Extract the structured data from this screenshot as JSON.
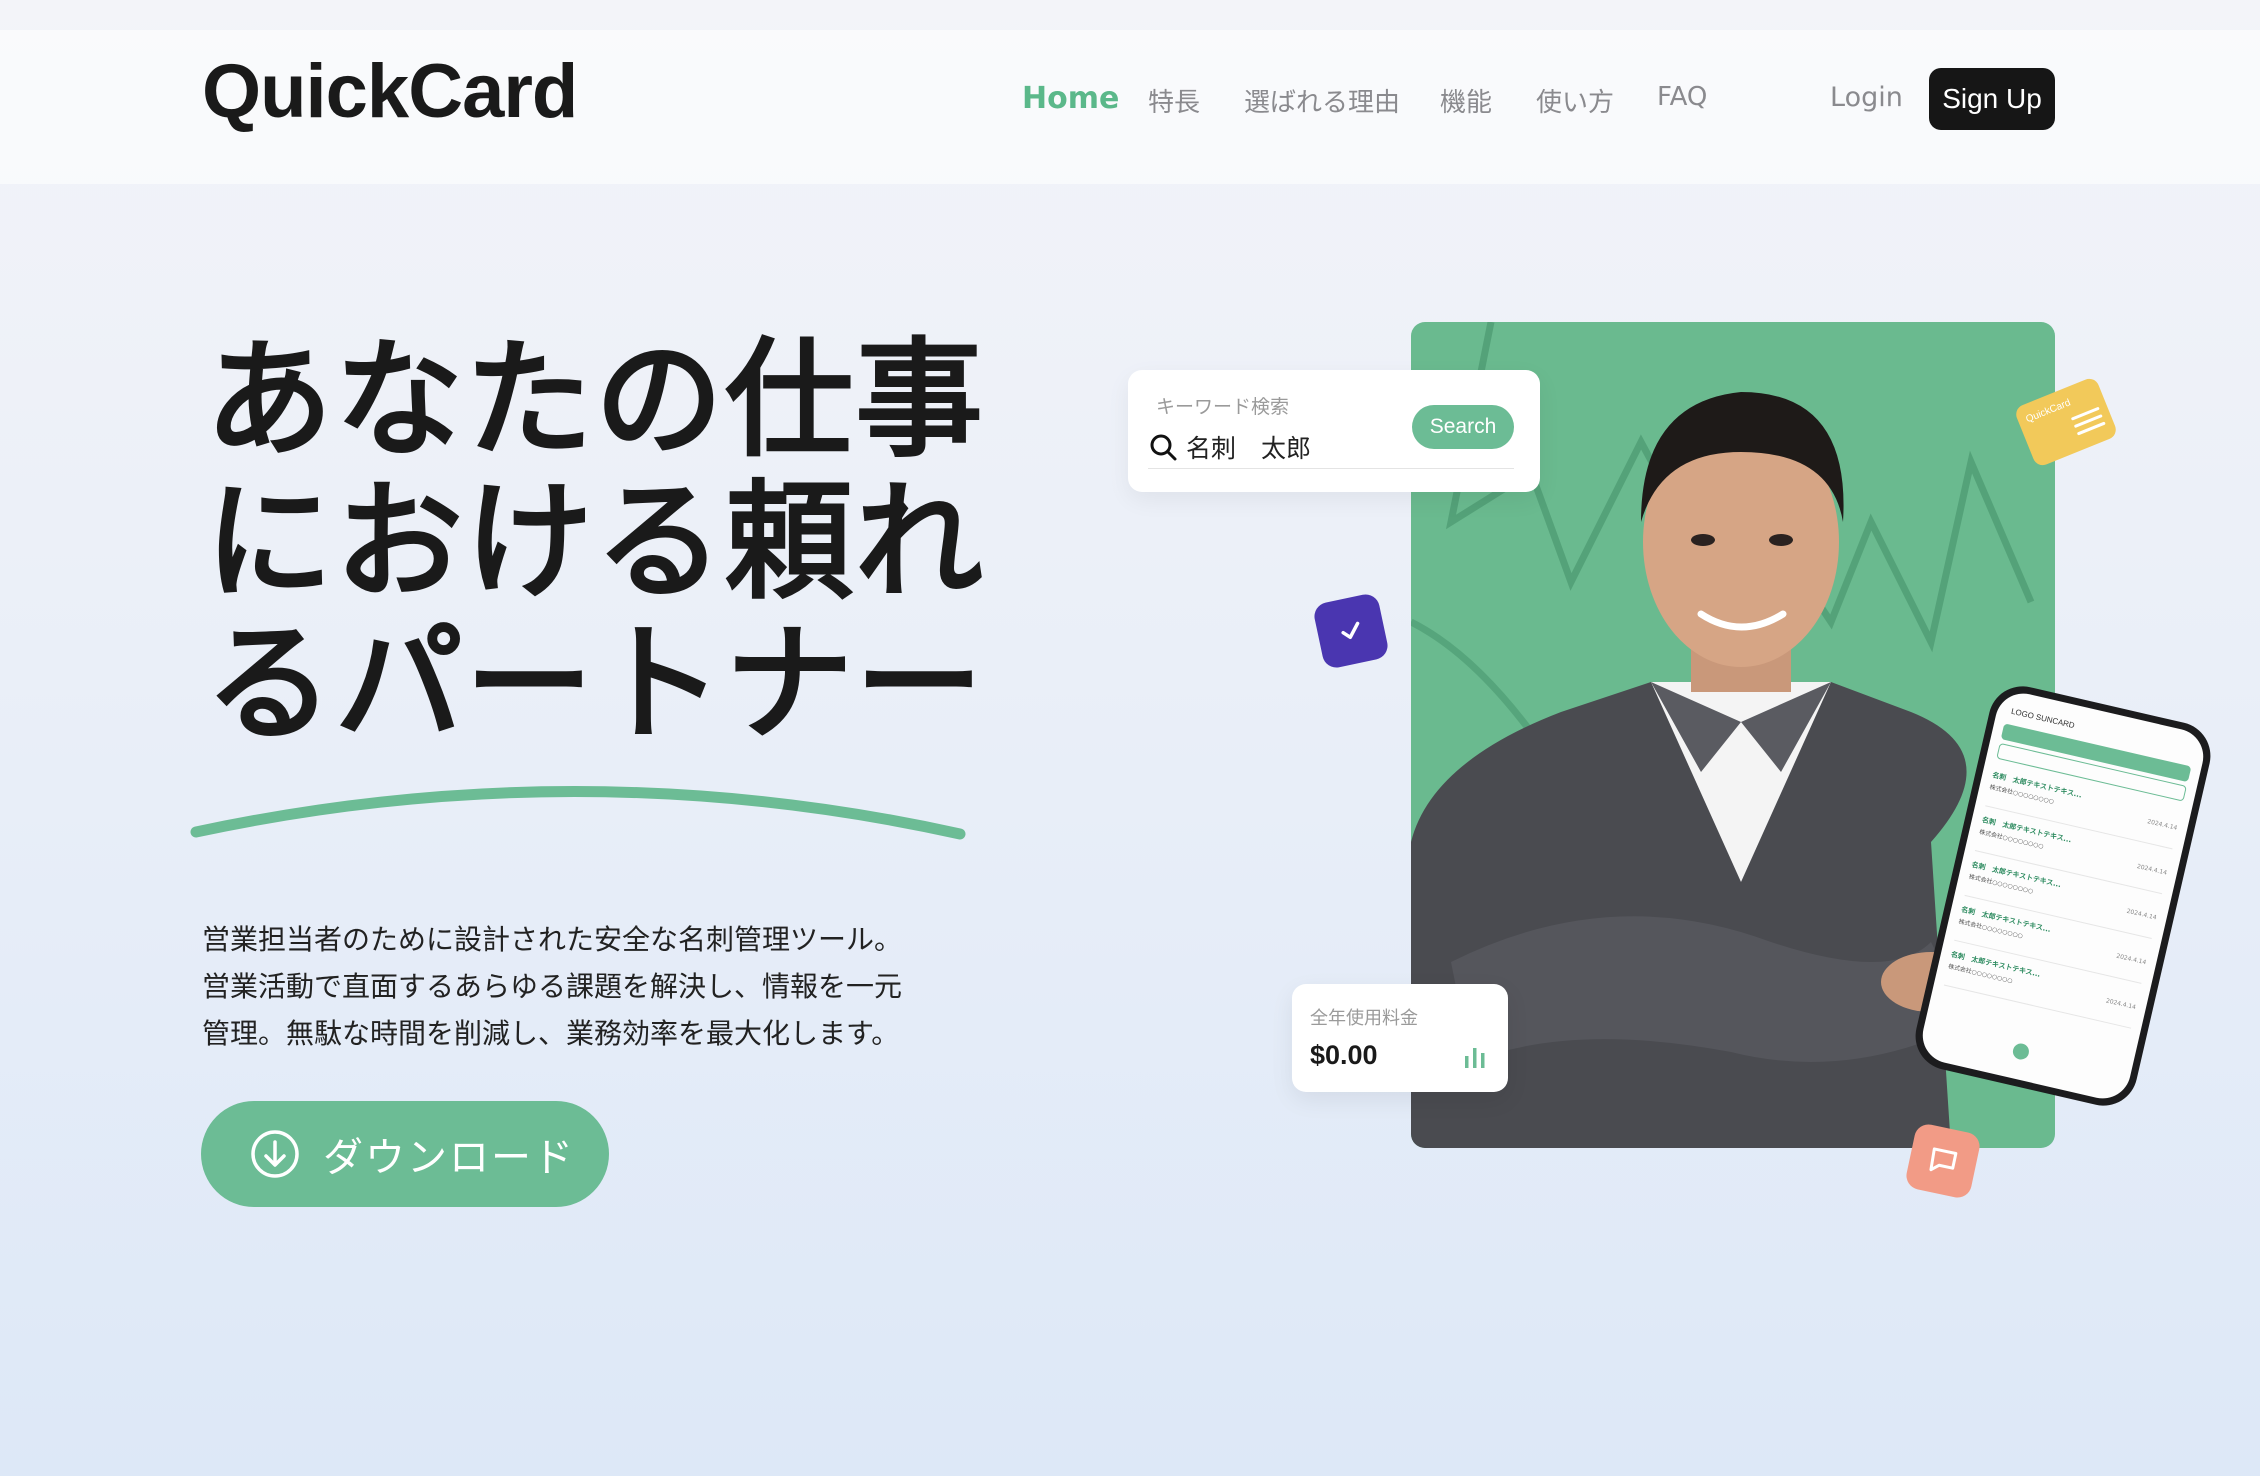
{
  "header": {
    "logo": "QuickCard",
    "nav": [
      {
        "label": "Home",
        "active": true
      },
      {
        "label": "特長",
        "active": false
      },
      {
        "label": "選ばれる理由",
        "active": false
      },
      {
        "label": "機能",
        "active": false
      },
      {
        "label": "使い方",
        "active": false
      },
      {
        "label": "FAQ",
        "active": false
      }
    ],
    "login_label": "Login",
    "signup_label": "Sign Up"
  },
  "hero": {
    "title_lines": [
      "あなたの仕事",
      "における頼れ",
      "るパートナー"
    ],
    "description_lines": [
      "営業担当者のために設計された安全な名刺管理ツール。",
      "営業活動で直面するあらゆる課題を解決し、情報を一元",
      "管理。無駄な時間を削減し、業務効率を最大化します。"
    ],
    "download_label": "ダウンロード"
  },
  "search_card": {
    "caption": "キーワード検索",
    "value": "名刺　太郎",
    "button_label": "Search"
  },
  "fee_card": {
    "label": "全年使用料金",
    "value": "$0.00"
  },
  "float_card": {
    "brand": "QuickCard"
  },
  "phone": {
    "header_text": "LOGO   SUNCARD",
    "rows": [
      {
        "name": "名刺　太郎テキストテキス...",
        "company": "株式会社○○○○○○○○",
        "date": "2024.4.14"
      },
      {
        "name": "名刺　太郎テキストテキス...",
        "company": "株式会社○○○○○○○○",
        "date": "2024.4.14"
      },
      {
        "name": "名刺　太郎テキストテキス...",
        "company": "株式会社○○○○○○○○",
        "date": "2024.4.14"
      },
      {
        "name": "名刺　太郎テキストテキス...",
        "company": "株式会社○○○○○○○○",
        "date": "2024.4.14"
      },
      {
        "name": "名刺　太郎テキストテキス...",
        "company": "株式会社○○○○○○○○",
        "date": "2024.4.14"
      }
    ]
  },
  "colors": {
    "accent": "#6cbc95",
    "text_dark": "#1a1a1a",
    "nav_gray": "#8a8a8e",
    "signup_bg": "#161616",
    "check_badge": "#4a36b0",
    "card_yellow": "#f2c95a",
    "chat_badge": "#f29b86"
  },
  "icons": {
    "download": "download-circle-icon",
    "search": "search-icon",
    "check": "check-icon",
    "chat": "chat-bubble-icon",
    "bar_chart": "bar-chart-icon"
  }
}
